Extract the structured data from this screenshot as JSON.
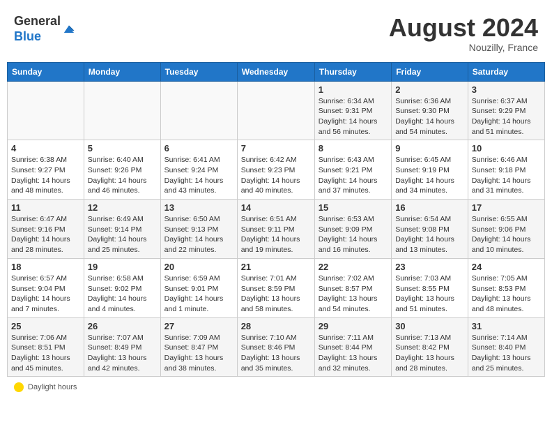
{
  "header": {
    "logo_general": "General",
    "logo_blue": "Blue",
    "month_year": "August 2024",
    "location": "Nouzilly, France"
  },
  "footer": {
    "daylight_label": "Daylight hours"
  },
  "weekdays": [
    "Sunday",
    "Monday",
    "Tuesday",
    "Wednesday",
    "Thursday",
    "Friday",
    "Saturday"
  ],
  "weeks": [
    [
      {
        "day": "",
        "info": ""
      },
      {
        "day": "",
        "info": ""
      },
      {
        "day": "",
        "info": ""
      },
      {
        "day": "",
        "info": ""
      },
      {
        "day": "1",
        "info": "Sunrise: 6:34 AM\nSunset: 9:31 PM\nDaylight: 14 hours and 56 minutes."
      },
      {
        "day": "2",
        "info": "Sunrise: 6:36 AM\nSunset: 9:30 PM\nDaylight: 14 hours and 54 minutes."
      },
      {
        "day": "3",
        "info": "Sunrise: 6:37 AM\nSunset: 9:29 PM\nDaylight: 14 hours and 51 minutes."
      }
    ],
    [
      {
        "day": "4",
        "info": "Sunrise: 6:38 AM\nSunset: 9:27 PM\nDaylight: 14 hours and 48 minutes."
      },
      {
        "day": "5",
        "info": "Sunrise: 6:40 AM\nSunset: 9:26 PM\nDaylight: 14 hours and 46 minutes."
      },
      {
        "day": "6",
        "info": "Sunrise: 6:41 AM\nSunset: 9:24 PM\nDaylight: 14 hours and 43 minutes."
      },
      {
        "day": "7",
        "info": "Sunrise: 6:42 AM\nSunset: 9:23 PM\nDaylight: 14 hours and 40 minutes."
      },
      {
        "day": "8",
        "info": "Sunrise: 6:43 AM\nSunset: 9:21 PM\nDaylight: 14 hours and 37 minutes."
      },
      {
        "day": "9",
        "info": "Sunrise: 6:45 AM\nSunset: 9:19 PM\nDaylight: 14 hours and 34 minutes."
      },
      {
        "day": "10",
        "info": "Sunrise: 6:46 AM\nSunset: 9:18 PM\nDaylight: 14 hours and 31 minutes."
      }
    ],
    [
      {
        "day": "11",
        "info": "Sunrise: 6:47 AM\nSunset: 9:16 PM\nDaylight: 14 hours and 28 minutes."
      },
      {
        "day": "12",
        "info": "Sunrise: 6:49 AM\nSunset: 9:14 PM\nDaylight: 14 hours and 25 minutes."
      },
      {
        "day": "13",
        "info": "Sunrise: 6:50 AM\nSunset: 9:13 PM\nDaylight: 14 hours and 22 minutes."
      },
      {
        "day": "14",
        "info": "Sunrise: 6:51 AM\nSunset: 9:11 PM\nDaylight: 14 hours and 19 minutes."
      },
      {
        "day": "15",
        "info": "Sunrise: 6:53 AM\nSunset: 9:09 PM\nDaylight: 14 hours and 16 minutes."
      },
      {
        "day": "16",
        "info": "Sunrise: 6:54 AM\nSunset: 9:08 PM\nDaylight: 14 hours and 13 minutes."
      },
      {
        "day": "17",
        "info": "Sunrise: 6:55 AM\nSunset: 9:06 PM\nDaylight: 14 hours and 10 minutes."
      }
    ],
    [
      {
        "day": "18",
        "info": "Sunrise: 6:57 AM\nSunset: 9:04 PM\nDaylight: 14 hours and 7 minutes."
      },
      {
        "day": "19",
        "info": "Sunrise: 6:58 AM\nSunset: 9:02 PM\nDaylight: 14 hours and 4 minutes."
      },
      {
        "day": "20",
        "info": "Sunrise: 6:59 AM\nSunset: 9:01 PM\nDaylight: 14 hours and 1 minute."
      },
      {
        "day": "21",
        "info": "Sunrise: 7:01 AM\nSunset: 8:59 PM\nDaylight: 13 hours and 58 minutes."
      },
      {
        "day": "22",
        "info": "Sunrise: 7:02 AM\nSunset: 8:57 PM\nDaylight: 13 hours and 54 minutes."
      },
      {
        "day": "23",
        "info": "Sunrise: 7:03 AM\nSunset: 8:55 PM\nDaylight: 13 hours and 51 minutes."
      },
      {
        "day": "24",
        "info": "Sunrise: 7:05 AM\nSunset: 8:53 PM\nDaylight: 13 hours and 48 minutes."
      }
    ],
    [
      {
        "day": "25",
        "info": "Sunrise: 7:06 AM\nSunset: 8:51 PM\nDaylight: 13 hours and 45 minutes."
      },
      {
        "day": "26",
        "info": "Sunrise: 7:07 AM\nSunset: 8:49 PM\nDaylight: 13 hours and 42 minutes."
      },
      {
        "day": "27",
        "info": "Sunrise: 7:09 AM\nSunset: 8:47 PM\nDaylight: 13 hours and 38 minutes."
      },
      {
        "day": "28",
        "info": "Sunrise: 7:10 AM\nSunset: 8:46 PM\nDaylight: 13 hours and 35 minutes."
      },
      {
        "day": "29",
        "info": "Sunrise: 7:11 AM\nSunset: 8:44 PM\nDaylight: 13 hours and 32 minutes."
      },
      {
        "day": "30",
        "info": "Sunrise: 7:13 AM\nSunset: 8:42 PM\nDaylight: 13 hours and 28 minutes."
      },
      {
        "day": "31",
        "info": "Sunrise: 7:14 AM\nSunset: 8:40 PM\nDaylight: 13 hours and 25 minutes."
      }
    ]
  ]
}
